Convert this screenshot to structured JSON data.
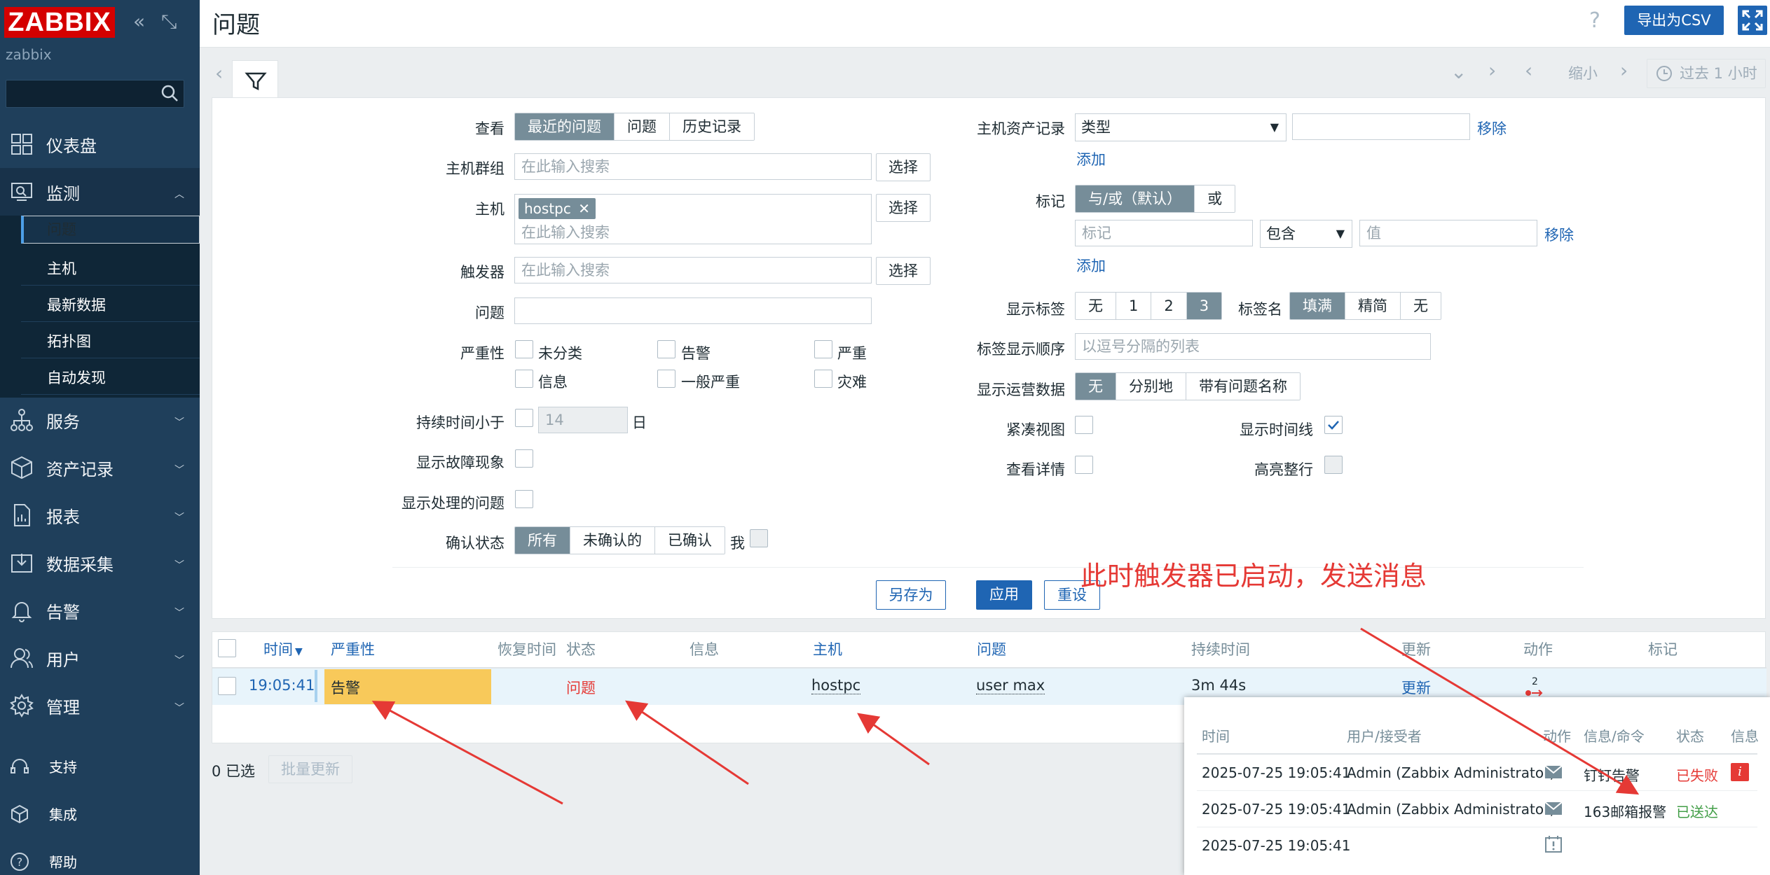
{
  "sidebar": {
    "logo": "ZABBIX",
    "subtitle": "zabbix",
    "search_placeholder": "",
    "menu": [
      {
        "label": "仪表盘",
        "icon": "dashboard-icon"
      },
      {
        "label": "监测",
        "icon": "monitoring-icon"
      },
      {
        "label": "服务",
        "icon": "services-icon"
      },
      {
        "label": "资产记录",
        "icon": "inventory-icon"
      },
      {
        "label": "报表",
        "icon": "reports-icon"
      },
      {
        "label": "数据采集",
        "icon": "data-collection-icon"
      },
      {
        "label": "告警",
        "icon": "alerts-icon"
      },
      {
        "label": "用户",
        "icon": "users-icon"
      },
      {
        "label": "管理",
        "icon": "administration-icon"
      }
    ],
    "submenu": [
      "问题",
      "主机",
      "最新数据",
      "拓扑图",
      "自动发现"
    ],
    "bottom": [
      {
        "label": "支持",
        "icon": "support-icon"
      },
      {
        "label": "集成",
        "icon": "integrations-icon"
      },
      {
        "label": "帮助",
        "icon": "help-icon"
      }
    ]
  },
  "header": {
    "title": "问题",
    "export_csv": "导出为CSV",
    "zoom_out": "缩小",
    "time_range": "过去 1 小时"
  },
  "filter": {
    "view_label": "查看",
    "view_options": [
      "最近的问题",
      "问题",
      "历史记录"
    ],
    "host_groups_label": "主机群组",
    "hosts_label": "主机",
    "triggers_label": "触发器",
    "problem_label": "问题",
    "severity_label": "严重性",
    "search_placeholder": "在此输入搜索",
    "select_btn": "选择",
    "host_tag": "hostpc",
    "severity": [
      "未分类",
      "告警",
      "严重",
      "信息",
      "一般严重",
      "灾难"
    ],
    "age_label": "持续时间小于",
    "age_value": "14",
    "age_unit": "日",
    "show_symptoms_label": "显示故障现象",
    "show_suppressed_label": "显示处理的问题",
    "ack_label": "确认状态",
    "ack_options": [
      "所有",
      "未确认的",
      "已确认"
    ],
    "by_me": "我",
    "inventory_label": "主机资产记录",
    "inventory_select": "类型",
    "remove": "移除",
    "add": "添加",
    "tags_label": "标记",
    "tags_options": [
      "与/或（默认）",
      "或"
    ],
    "tag_placeholder": "标记",
    "tag_op": "包含",
    "value_placeholder": "值",
    "show_tags_label": "显示标签",
    "show_tags_options": [
      "无",
      "1",
      "2",
      "3"
    ],
    "tag_name_label": "标签名",
    "tag_name_options": [
      "填满",
      "精简",
      "无"
    ],
    "tag_priority_label": "标签显示顺序",
    "tag_priority_placeholder": "以逗号分隔的列表",
    "opdata_label": "显示运营数据",
    "opdata_options": [
      "无",
      "分别地",
      "带有问题名称"
    ],
    "compact_label": "紧凑视图",
    "timeline_label": "显示时间线",
    "details_label": "查看详情",
    "highlight_label": "高亮整行",
    "save_as": "另存为",
    "apply": "应用",
    "reset": "重设"
  },
  "table": {
    "headers": [
      "时间",
      "严重性",
      "恢复时间",
      "状态",
      "信息",
      "主机",
      "问题",
      "持续时间",
      "更新",
      "动作",
      "标记"
    ],
    "row": {
      "time": "19:05:41",
      "severity": "告警",
      "status": "问题",
      "host": "hostpc",
      "problem": "user max",
      "duration": "3m 44s",
      "update": "更新",
      "actions_count": "2"
    },
    "selected": "0 已选",
    "mass_update": "批量更新"
  },
  "popup": {
    "headers": [
      "时间",
      "用户/接受者",
      "动作",
      "信息/命令",
      "状态",
      "信息"
    ],
    "rows": [
      {
        "time": "2025-07-25 19:05:41",
        "user": "Admin (Zabbix Administrator)",
        "message": "钉钉告警",
        "status": "已失败",
        "status_color": "#e53935"
      },
      {
        "time": "2025-07-25 19:05:41",
        "user": "Admin (Zabbix Administrator)",
        "message": "163邮箱报警",
        "status": "已送达",
        "status_color": "#429e47"
      },
      {
        "time": "2025-07-25 19:05:41",
        "user": "",
        "message": "",
        "status": "",
        "status_color": ""
      }
    ]
  },
  "annotation": "此时触发器已启动，发送消息",
  "colors": {
    "sidebar": "#1f3f5b",
    "accent": "#1f65b3",
    "warning": "#f8c95a",
    "annotation": "#e53935"
  }
}
